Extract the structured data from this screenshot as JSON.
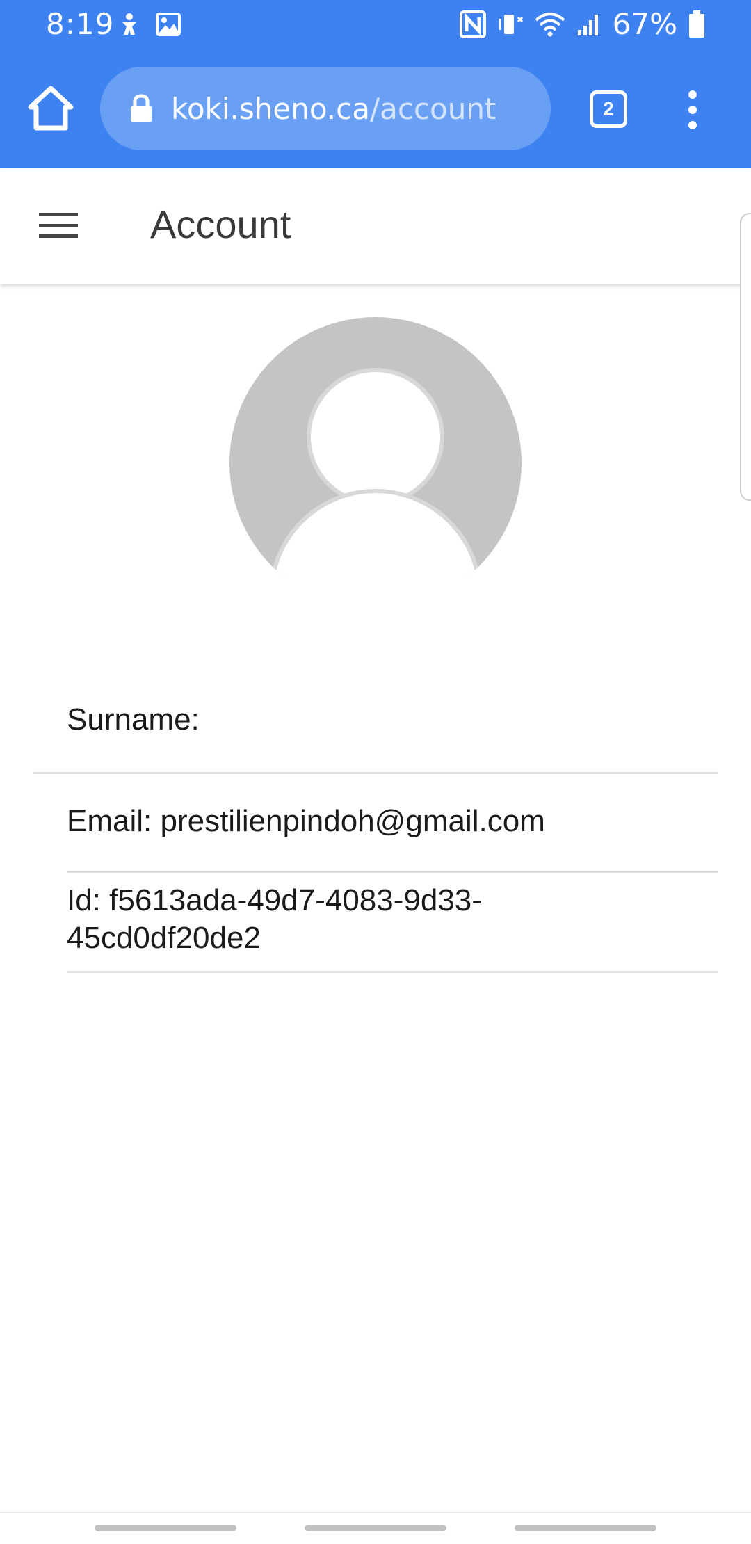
{
  "status_bar": {
    "time": "8:19",
    "battery_percent": "67%",
    "left_icons": [
      "accessibility-icon",
      "image-icon"
    ],
    "right_icons": [
      "nfc-icon",
      "vibrate-mute-icon",
      "wifi-icon",
      "signal-icon",
      "battery-icon"
    ]
  },
  "browser": {
    "url_domain": "koki.sheno.ca",
    "url_path": "/account",
    "tab_count": "2",
    "theme_color": "#3d82f0"
  },
  "app_bar": {
    "title": "Account"
  },
  "profile": {
    "surname_label": "Surname:",
    "email_label": "Email: prestilienpindoh@gmail.com",
    "id_line1": "Id: f5613ada-49d7-4083-9d33-",
    "id_line2": "45cd0df20de2"
  }
}
